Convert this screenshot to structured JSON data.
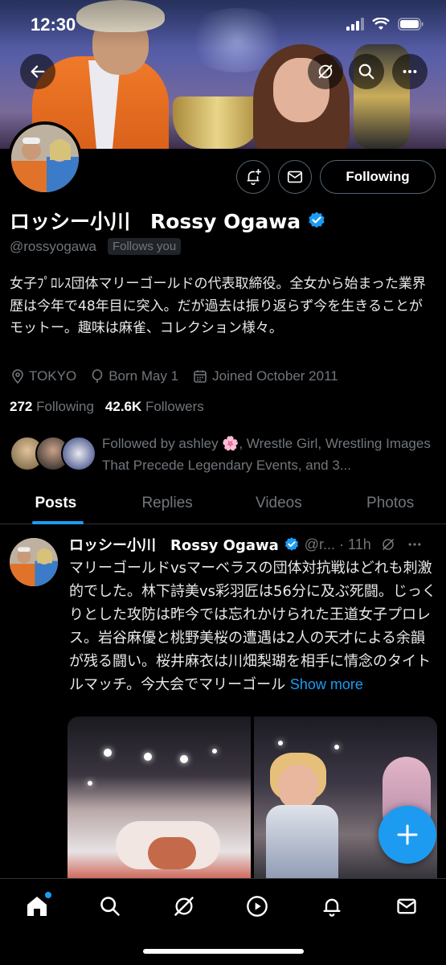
{
  "status_bar": {
    "time": "12:30"
  },
  "profile": {
    "display_name": "ロッシー小川　Rossy Ogawa",
    "handle": "@rossyogawa",
    "follows_you": "Follows you",
    "bio": "女子ﾌﾟﾛﾚｽ団体マリーゴールドの代表取締役。全女から始まった業界歴は今年で48年目に突入。だが過去は振り返らず今を生きることがモットー。趣味は麻雀、コレクション様々。",
    "location": "TOKYO",
    "birthday": "Born May 1",
    "joined": "Joined October 2011",
    "following_count": "272",
    "following_label": "Following",
    "followers_count": "42.6K",
    "followers_label": "Followers",
    "followed_by": "Followed by ashley 🌸, Wrestle Girl, Wrestling Images That Precede Legendary Events, and 3...",
    "following_button": "Following"
  },
  "tabs": [
    {
      "label": "Posts",
      "active": true
    },
    {
      "label": "Replies",
      "active": false
    },
    {
      "label": "Videos",
      "active": false
    },
    {
      "label": "Photos",
      "active": false
    }
  ],
  "post": {
    "name": "ロッシー小川　Rossy Ogawa",
    "handle_time": "@r... · 11h",
    "text": "マリーゴールドvsマーベラスの団体対抗戦はどれも刺激的でした。林下詩美vs彩羽匠は56分に及ぶ死闘。じっくりとした攻防は昨今では忘れかけられた王道女子プロレス。岩谷麻優と桃野美桜の遭遇は2人の天才による余韻が残る闘い。桜井麻衣は川畑梨瑚を相手に情念のタイトルマッチ。今大会でマリーゴール",
    "show_more": "Show more"
  },
  "colors": {
    "accent": "#1d9bf0",
    "background": "#000000",
    "secondary_text": "#71767b"
  },
  "icons": {
    "back": "arrow-left-icon",
    "grok": "grok-icon",
    "search": "search-icon",
    "more": "more-icon",
    "notify": "bell-plus-icon",
    "message": "mail-icon",
    "verified": "verified-badge-icon",
    "compose": "plus-icon"
  },
  "bottom_nav": [
    "home",
    "search",
    "grok",
    "video",
    "notifications",
    "messages"
  ]
}
